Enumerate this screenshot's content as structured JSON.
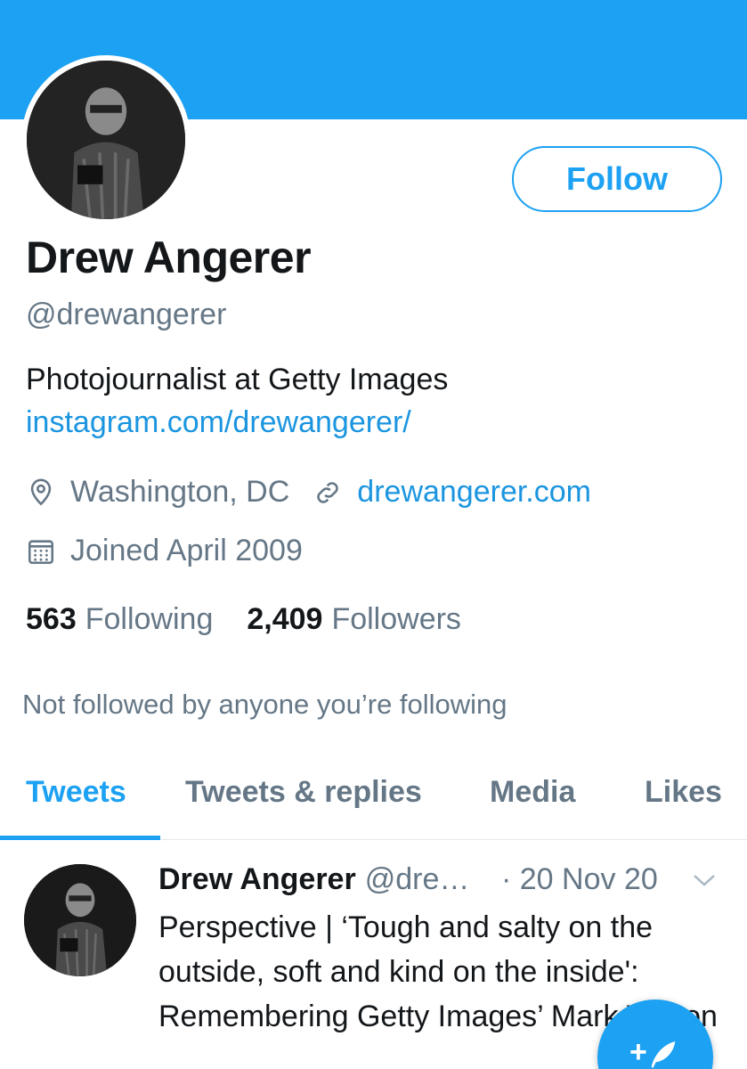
{
  "profile": {
    "name": "Drew Angerer",
    "handle": "@drewangerer",
    "bio": "Photojournalist at Getty Images",
    "bio_link": "instagram.com/drewangerer/",
    "location": "Washington, DC",
    "website": "drewangerer.com",
    "joined": "Joined April 2009",
    "follow_label": "Follow",
    "following_count": "563",
    "following_label": "Following",
    "followers_count": "2,409",
    "followers_label": "Followers",
    "social_context": "Not followed by anyone you’re following"
  },
  "tabs": [
    {
      "label": "Tweets",
      "active": true
    },
    {
      "label": "Tweets & replies",
      "active": false
    },
    {
      "label": "Media",
      "active": false
    },
    {
      "label": "Likes",
      "active": false
    }
  ],
  "tweet": {
    "author_name": "Drew Angerer",
    "author_handle": "@dre…",
    "date": "· 20 Nov 20",
    "text": "Perspective | ‘Tough and salty on the outside, soft and kind on the inside': Remembering Getty Images’ Mark Wilson"
  },
  "fab": {
    "plus": "+"
  },
  "icons": {
    "location": "location-pin-icon",
    "website": "link-icon",
    "joined": "calendar-icon",
    "tweet_menu": "chevron-down-icon",
    "compose": "compose-quill-icon"
  },
  "colors": {
    "accent": "#1da1f2",
    "link": "#1b95e0",
    "muted": "#657786",
    "text": "#14171a"
  }
}
